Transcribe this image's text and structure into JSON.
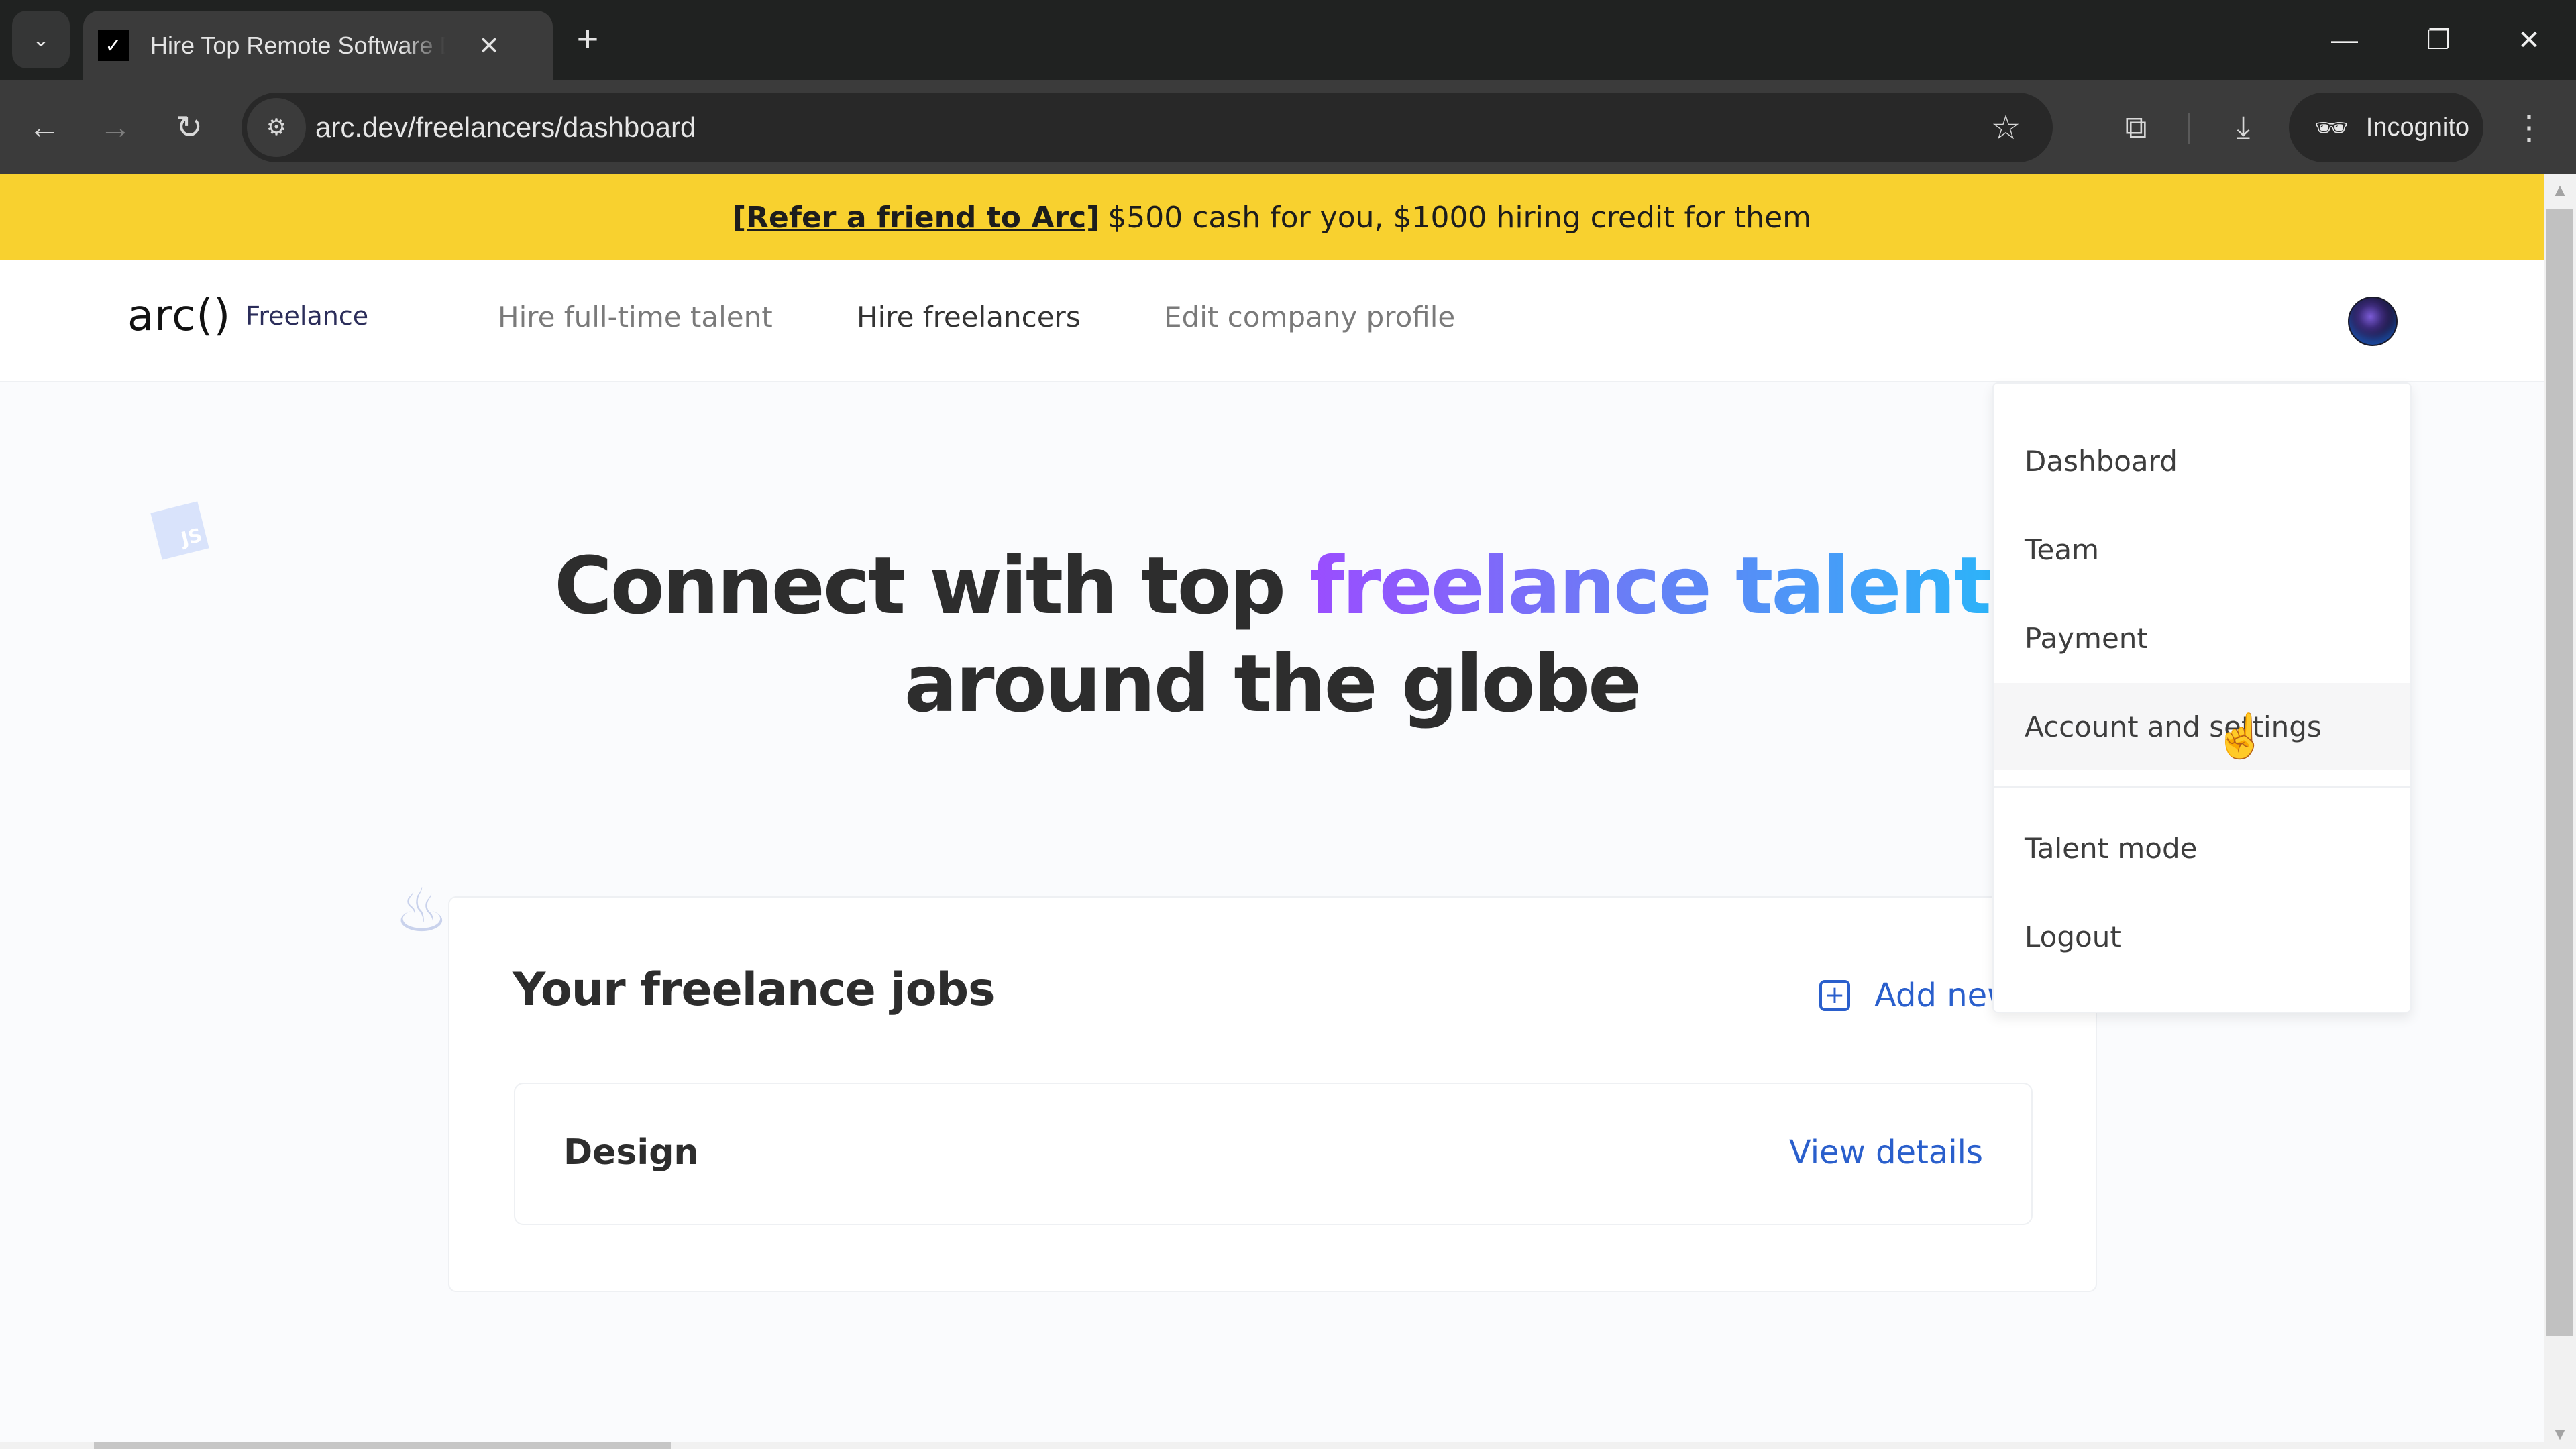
{
  "browser": {
    "tab": {
      "title": "Hire Top Remote Software Developers",
      "close_icon": "close-icon",
      "favicon": "arc-favicon"
    },
    "new_tab_icon": "plus-icon",
    "window_controls": {
      "minimize": "—",
      "restore": "❐",
      "close": "✕"
    },
    "toolbar": {
      "back": "←",
      "forward": "→",
      "reload": "↻",
      "url": "arc.dev/freelancers/dashboard",
      "bookmark_icon": "☆",
      "extensions_icon": "⧉",
      "download_icon": "⤓",
      "incognito_label": "Incognito",
      "menu_icon": "⋮"
    }
  },
  "banner": {
    "link_text": "[Refer a friend to Arc]",
    "text": "$500 cash for you, $1000 hiring credit for them",
    "color": "#f8d12f"
  },
  "header": {
    "logo": "arc()",
    "logo_sub": "Freelance",
    "nav": [
      {
        "label": "Hire full-time talent",
        "active": false
      },
      {
        "label": "Hire freelancers",
        "active": true
      },
      {
        "label": "Edit company profile",
        "active": false
      }
    ]
  },
  "hero": {
    "line1_plain": "Connect with top ",
    "line1_highlight": "freelance talent",
    "line2": "around the globe",
    "gradient_colors": [
      "#9b4dff",
      "#2db3f9"
    ]
  },
  "jobs": {
    "title": "Your freelance jobs",
    "add_new_label": "Add new",
    "items": [
      {
        "name": "Design",
        "action": "View details"
      }
    ],
    "accent": "#2a5fcc"
  },
  "user_menu": {
    "items": [
      {
        "label": "Dashboard"
      },
      {
        "label": "Team"
      },
      {
        "label": "Payment"
      },
      {
        "label": "Account and settings",
        "hovered": true
      },
      {
        "label": "Talent mode"
      },
      {
        "label": "Logout"
      }
    ]
  },
  "background_icons": {
    "js": "JS",
    "java": "♨"
  }
}
